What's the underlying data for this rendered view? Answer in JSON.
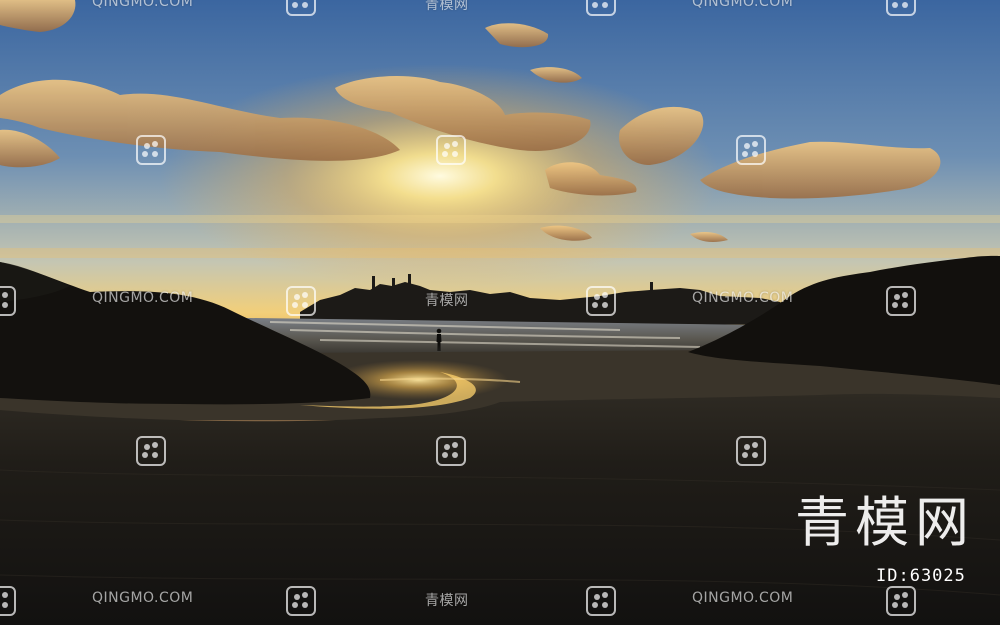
{
  "watermark": {
    "latin": "QINGMO.COM",
    "cjk": "青模网",
    "brand": "青模网",
    "id_label": "ID:63025",
    "icon": "qingmo-logo-icon"
  },
  "scene": {
    "subject": "sunset over beach with silhouetted rocks and lone walker",
    "colors": {
      "sky_top": "#3d6aa2",
      "sky_mid": "#9fb6c2",
      "sun_glow": "#fff2b0",
      "horizon": "#f0b845",
      "sand": "#1c1a16",
      "rock": "#14120f",
      "cloud": "#d29a52"
    }
  }
}
